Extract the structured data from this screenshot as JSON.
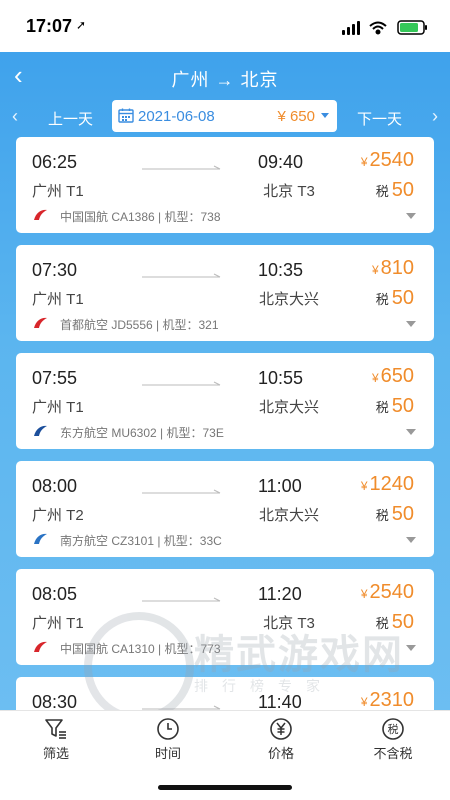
{
  "status": {
    "time": "17:07",
    "loc": "➚"
  },
  "header": {
    "title": "广州 → 北京",
    "back": "‹"
  },
  "date_bar": {
    "prev_label": "上一天",
    "next_label": "下一天",
    "date": "2021-06-08",
    "price": "¥ 650",
    "arrow_left": "‹",
    "arrow_right": "›"
  },
  "flights": [
    {
      "dep_time": "06:25",
      "arr_time": "09:40",
      "dep_airport": "广州 T1",
      "arr_airport": "北京 T3",
      "yen": "¥",
      "price": "2540",
      "tax_label": "税",
      "tax": "50",
      "airline": "中国国航 CA1386 | 机型：738",
      "logo_color": "#d8262b"
    },
    {
      "dep_time": "07:30",
      "arr_time": "10:35",
      "dep_airport": "广州 T1",
      "arr_airport": "北京大兴",
      "yen": "¥",
      "price": "810",
      "tax_label": "税",
      "tax": "50",
      "airline": "首都航空 JD5556 | 机型：321",
      "logo_color": "#d8262b"
    },
    {
      "dep_time": "07:55",
      "arr_time": "10:55",
      "dep_airport": "广州 T1",
      "arr_airport": "北京大兴",
      "yen": "¥",
      "price": "650",
      "tax_label": "税",
      "tax": "50",
      "airline": "东方航空 MU6302 | 机型：73E",
      "logo_color": "#1c4f9c"
    },
    {
      "dep_time": "08:00",
      "arr_time": "11:00",
      "dep_airport": "广州 T2",
      "arr_airport": "北京大兴",
      "yen": "¥",
      "price": "1240",
      "tax_label": "税",
      "tax": "50",
      "airline": "南方航空 CZ3101 | 机型：33C",
      "logo_color": "#2a73c4"
    },
    {
      "dep_time": "08:05",
      "arr_time": "11:20",
      "dep_airport": "广州 T1",
      "arr_airport": "北京 T3",
      "yen": "¥",
      "price": "2540",
      "tax_label": "税",
      "tax": "50",
      "airline": "中国国航 CA1310 | 机型：773",
      "logo_color": "#d8262b"
    },
    {
      "dep_time": "08:30",
      "arr_time": "11:40",
      "dep_airport": "",
      "arr_airport": "",
      "yen": "¥",
      "price": "2310",
      "tax_label": "",
      "tax": "",
      "airline": "",
      "logo_color": "#d8262b"
    }
  ],
  "tabs": [
    {
      "label": "筛选",
      "icon": "filter-icon"
    },
    {
      "label": "时间",
      "icon": "clock-icon"
    },
    {
      "label": "价格",
      "icon": "yuan-icon"
    },
    {
      "label": "不含税",
      "icon": "tax-icon",
      "glyph": "税"
    }
  ],
  "watermark": {
    "main": "精武游戏网",
    "sub": "排行榜专家"
  },
  "colors": {
    "accent": "#3a8de0",
    "price": "#f08c2b",
    "header": "#4aa8ee"
  }
}
